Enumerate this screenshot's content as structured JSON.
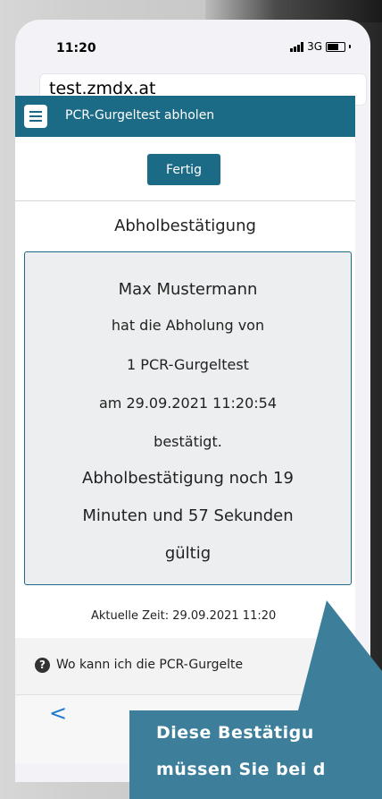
{
  "status_bar": {
    "time": "11:20",
    "network": "3G"
  },
  "browser": {
    "url": "test.zmdx.at"
  },
  "header": {
    "title": "PCR-Gurgeltest abholen"
  },
  "content": {
    "done_button": "Fertig",
    "confirmation_title": "Abholbestätigung",
    "box_lines": [
      "Max Mustermann",
      "hat die Abholung von",
      "1 PCR-Gurgeltest",
      "am 29.09.2021 11:20:54",
      "bestätigt.",
      "Abholbestätigung noch 19",
      "Minuten und 57 Sekunden",
      "gültig"
    ],
    "current_time": "Aktuelle Zeit: 29.09.2021 11:20"
  },
  "info": {
    "help_text": "Wo kann ich die PCR-Gurgelte"
  },
  "toolbar": {
    "back_glyph": "<"
  },
  "callout": {
    "line1": "Diese Bestätigu",
    "line2": "müssen Sie bei d"
  },
  "colors": {
    "accent": "#1b6a86",
    "callout": "#3d7f9a",
    "link": "#1f78d1"
  }
}
